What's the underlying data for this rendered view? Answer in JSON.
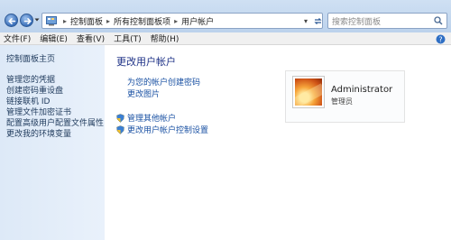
{
  "address": {
    "crumbs": [
      "控制面板",
      "所有控制面板项",
      "用户帐户"
    ],
    "search_placeholder": "搜索控制面板"
  },
  "menu": {
    "items": [
      "文件(F)",
      "编辑(E)",
      "查看(V)",
      "工具(T)",
      "帮助(H)"
    ]
  },
  "sidebar": {
    "home": "控制面板主页",
    "links": [
      "管理您的凭据",
      "创建密码重设盘",
      "链接联机 ID",
      "管理文件加密证书",
      "配置高级用户配置文件属性",
      "更改我的环境变量"
    ]
  },
  "main": {
    "title": "更改用户帐户",
    "links": [
      "为您的帐户创建密码",
      "更改图片"
    ],
    "admin_links": [
      "管理其他帐户",
      "更改用户帐户控制设置"
    ]
  },
  "user": {
    "name": "Administrator",
    "role": "管理员"
  },
  "colors": {
    "link": "#1a51a3",
    "title": "#1e3287",
    "sidebar_bg": "#dde9f7"
  },
  "icons": {
    "back": "back-arrow-icon",
    "forward": "forward-arrow-icon",
    "search": "search-icon",
    "refresh": "refresh-icon",
    "shield": "uac-shield-icon",
    "control_panel": "control-panel-icon"
  }
}
